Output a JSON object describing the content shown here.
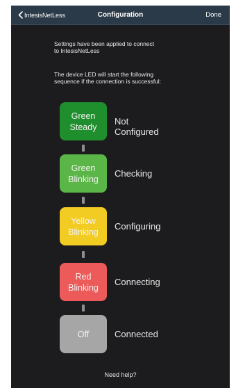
{
  "nav": {
    "back_label": "IntesisNetLess",
    "title": "Configuration",
    "done_label": "Done"
  },
  "message1": "Settings have been applied to connect\nto IntesisNetLess",
  "message2": "The device LED will start the following\nsequence if the connection is successful:",
  "steps": [
    {
      "led": "Green\nSteady",
      "state": "Not Configured",
      "color": "#1f8e2c"
    },
    {
      "led": "Green\nBlinking",
      "state": "Checking",
      "color": "#5ab646"
    },
    {
      "led": "Yellow\nBlinking",
      "state": "Configuring",
      "color": "#f3cc23"
    },
    {
      "led": "Red\nBlinking",
      "state": "Connecting",
      "color": "#ec5a5a"
    },
    {
      "led": "Off",
      "state": "Connected",
      "color": "#a6a6a6"
    }
  ],
  "help_label": "Need help?"
}
